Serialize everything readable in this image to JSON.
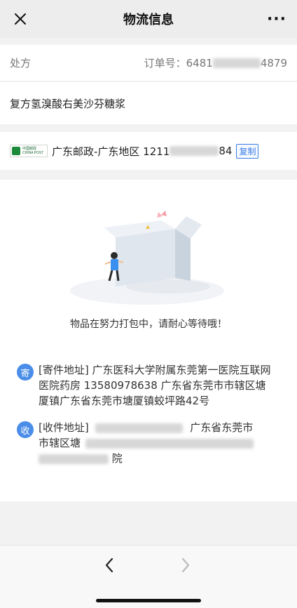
{
  "nav": {
    "title": "物流信息",
    "close_icon": "close-icon",
    "more_icon": "more-icon",
    "more_text": "···"
  },
  "order": {
    "label": "处方",
    "prefix": "订单号：6481",
    "suffix": "4879"
  },
  "product": {
    "name": "复方氢溴酸右美沙芬糖浆"
  },
  "carrier": {
    "logo_text_cn": "中国邮政",
    "logo_text_en": "CHINA POST",
    "name": "广东邮政-广东地区 1211",
    "tracking_suffix": "84",
    "copy_label": "复制"
  },
  "status": {
    "message": "物品在努力打包中，请耐心等待哦！"
  },
  "sender": {
    "badge": "寄",
    "text": "[寄件地址] 广东医科大学附属东莞第一医院互联网医院药房 13580978638  广东省东莞市市辖区塘厦镇广东省东莞市塘厦镇蛟坪路42号"
  },
  "receiver": {
    "badge": "收",
    "label": "[收件地址]",
    "visible_1": "广东省东莞市",
    "visible_2": "市辖区塘",
    "visible_3": "院"
  },
  "colors": {
    "accent": "#4a8de8",
    "copy": "#3b7ee3",
    "post_green": "#1c8a3a"
  }
}
